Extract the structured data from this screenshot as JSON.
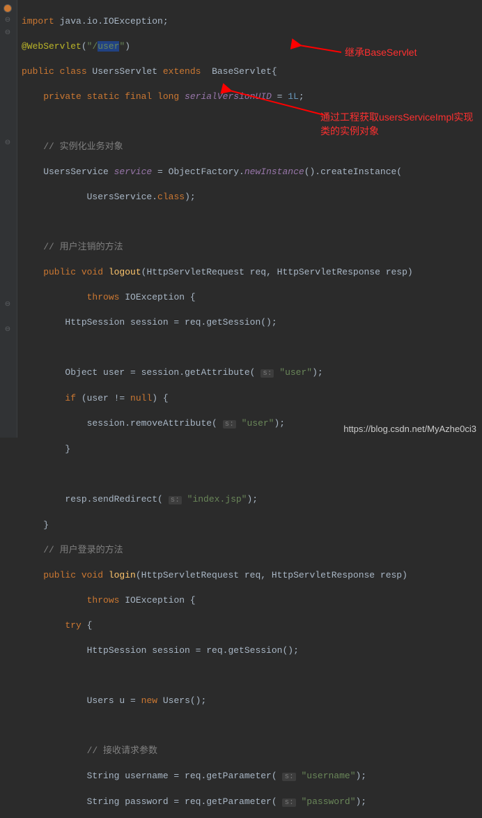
{
  "code": {
    "l1_import": "import",
    "l1_pkg": " java.io.IOException;",
    "l2_ann": "@WebServlet",
    "l2_p1": "(",
    "l2_str": "\"/user\"",
    "l2_p2": ")",
    "l3_pub": "public class ",
    "l3_cls": "UsersServlet ",
    "l3_ext": "extends ",
    "l3_base": " BaseServlet{",
    "l4": "    private static final long ",
    "l4_var": "serialVersionUID",
    "l4_eq": " = ",
    "l4_num": "1L",
    "l4_semi": ";",
    "l6_cmt": "    // 实例化业务对象",
    "l7_a": "    UsersService ",
    "l7_var": "service",
    "l7_b": " = ObjectFactory.",
    "l7_m": "newInstance",
    "l7_c": "().createInstance(",
    "l8_a": "            UsersService.",
    "l8_b": "class",
    "l8_c": ");",
    "l10_cmt": "    // 用户注销的方法",
    "l11_a": "    public void ",
    "l11_m": "logout",
    "l11_b": "(HttpServletRequest req, HttpServletResponse resp)",
    "l12_a": "            throws ",
    "l12_b": "IOException ",
    "l12_c": "{",
    "l13": "        HttpSession session = req.getSession();",
    "l15_a": "        Object user = session.getAttribute( ",
    "l15_hint": "s:",
    "l15_b": " ",
    "l15_str": "\"user\"",
    "l15_c": ");",
    "l16_a": "        if ",
    "l16_b": "(user != ",
    "l16_null": "null",
    "l16_c": ") {",
    "l17_a": "            session.removeAttribute( ",
    "l17_hint": "s:",
    "l17_b": " ",
    "l17_str": "\"user\"",
    "l17_c": ");",
    "l18": "        }",
    "l20_a": "        resp.sendRedirect( ",
    "l20_hint": "s:",
    "l20_b": " ",
    "l20_str": "\"index.jsp\"",
    "l20_c": ");",
    "l21": "    }",
    "l22_cmt": "    // 用户登录的方法",
    "l23_a": "    public void ",
    "l23_m": "login",
    "l23_b": "(HttpServletRequest req, HttpServletResponse resp)",
    "l24_a": "            throws ",
    "l24_b": "IOException ",
    "l24_c": "{",
    "l25_a": "        try ",
    "l25_b": "{",
    "l26": "            HttpSession session = req.getSession();",
    "l28_a": "            Users u = ",
    "l28_new": "new ",
    "l28_b": "Users();",
    "l30_cmt": "            // 接收请求参数",
    "l31_a": "            String username = req.getParameter( ",
    "l31_hint": "s:",
    "l31_b": " ",
    "l31_str": "\"username\"",
    "l31_c": ");",
    "l32_a": "            String password = req.getParameter( ",
    "l32_hint": "s:",
    "l32_b": " ",
    "l32_str": "\"password\"",
    "l32_c": ");"
  },
  "annotations": {
    "a1": "继承BaseServlet",
    "a2": "通过工程获取usersServiceImpl实现类的实例对象"
  },
  "watermark": "https://blog.csdn.net/MyAzhe0ci3"
}
